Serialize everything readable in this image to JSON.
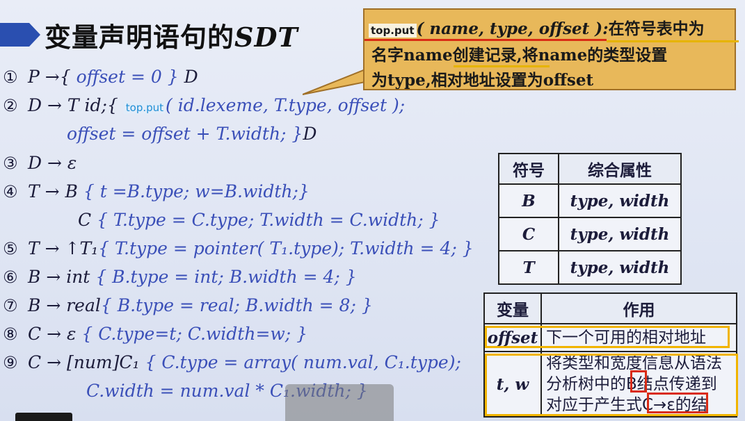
{
  "title": {
    "prefix": "变量声明语句的",
    "sdt": "SDT"
  },
  "callout": {
    "func": "top.put",
    "params": "( name, type, offset ):",
    "line1_tail": "在符号表中为",
    "line2": "名字name创建记录,将name的类型设置",
    "line3": "为type,相对地址设置为offset"
  },
  "rules": [
    {
      "num": "①",
      "text": "P →{ ",
      "action": "offset = 0 }",
      "tail": " D"
    },
    {
      "num": "②",
      "text": "D → T id;{ ",
      "func": "top.put",
      "action": "( id.lexeme, T.type, offset );"
    },
    {
      "num": "",
      "action": "offset = offset + T.width; }",
      "tail": "D"
    },
    {
      "num": "③",
      "text": "D → ε"
    },
    {
      "num": "④",
      "text": "T → B  ",
      "action": "{ t =B.type; w=B.width;}"
    },
    {
      "num": "",
      "text": "C  ",
      "action": "{ T.type = C.type; T.width = C.width; }"
    },
    {
      "num": "⑤",
      "text": "T → ↑T₁",
      "action": "{ T.type = pointer( T₁.type); T.width = 4; }"
    },
    {
      "num": "⑥",
      "text": "B → int ",
      "action": "{ B.type = int; B.width = 4; }"
    },
    {
      "num": "⑦",
      "text": "B → real",
      "action": "{ B.type = real; B.width = 8; }"
    },
    {
      "num": "⑧",
      "text": "C → ε  ",
      "action": "{ C.type=t; C.width=w; }"
    },
    {
      "num": "⑨",
      "text": "C → [num]C₁ ",
      "action": "{ C.type = array( num.val, C₁.type);"
    },
    {
      "num": "",
      "action": "C.width = num.val * C₁.width; }"
    }
  ],
  "attr_table": {
    "headers": [
      "符号",
      "综合属性"
    ],
    "rows": [
      [
        "B",
        "type, width"
      ],
      [
        "C",
        "type, width"
      ],
      [
        "T",
        "type, width"
      ]
    ]
  },
  "var_table": {
    "headers": [
      "变量",
      "作用"
    ],
    "rows": [
      {
        "var": "offset",
        "desc": "下一个可用的相对地址"
      },
      {
        "var": "t, w",
        "desc_lines": [
          "将类型和宽度信息从语法",
          "分析树中的B结点传递到",
          "对应于产生式C→ε的结"
        ]
      }
    ]
  },
  "colors": {
    "callout_bg": "#e8b85a",
    "action_blue": "#3a4fb8",
    "highlight_yellow": "#f1b400",
    "highlight_red": "#d92b15"
  }
}
